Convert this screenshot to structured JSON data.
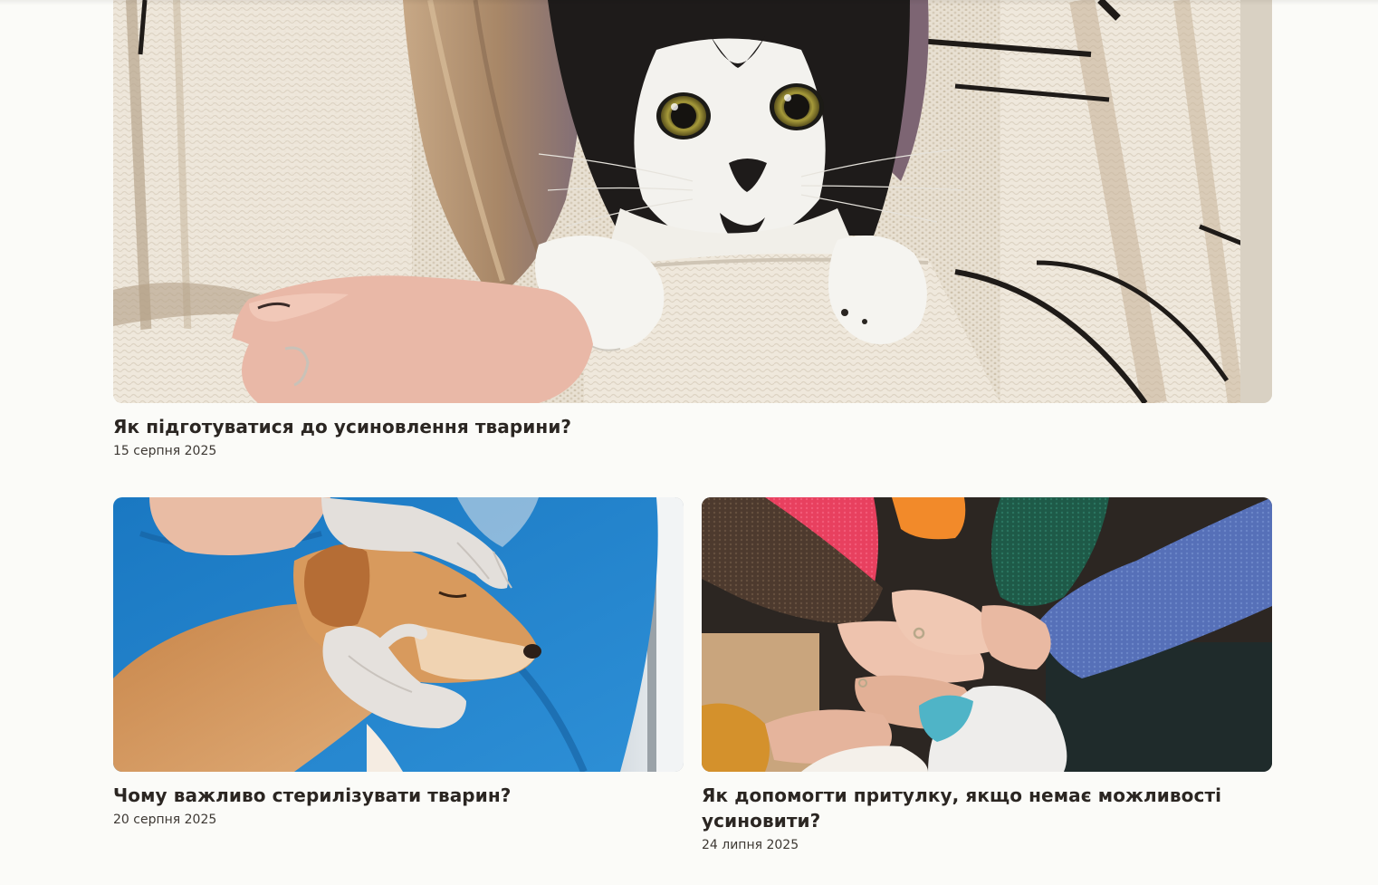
{
  "articles": [
    {
      "title": "Як підготуватися до усиновлення тварини?",
      "date": "15 серпня 2025",
      "image": "cat-in-sweater-photo"
    },
    {
      "title": "Чому важливо стерилізувати тварин?",
      "date": "20 серпня 2025",
      "image": "vet-with-dog-photo"
    },
    {
      "title": "Як допомогти притулку, якщо немає можливості усиновити?",
      "date": "24 липня 2025",
      "image": "stacked-hands-photo"
    }
  ]
}
